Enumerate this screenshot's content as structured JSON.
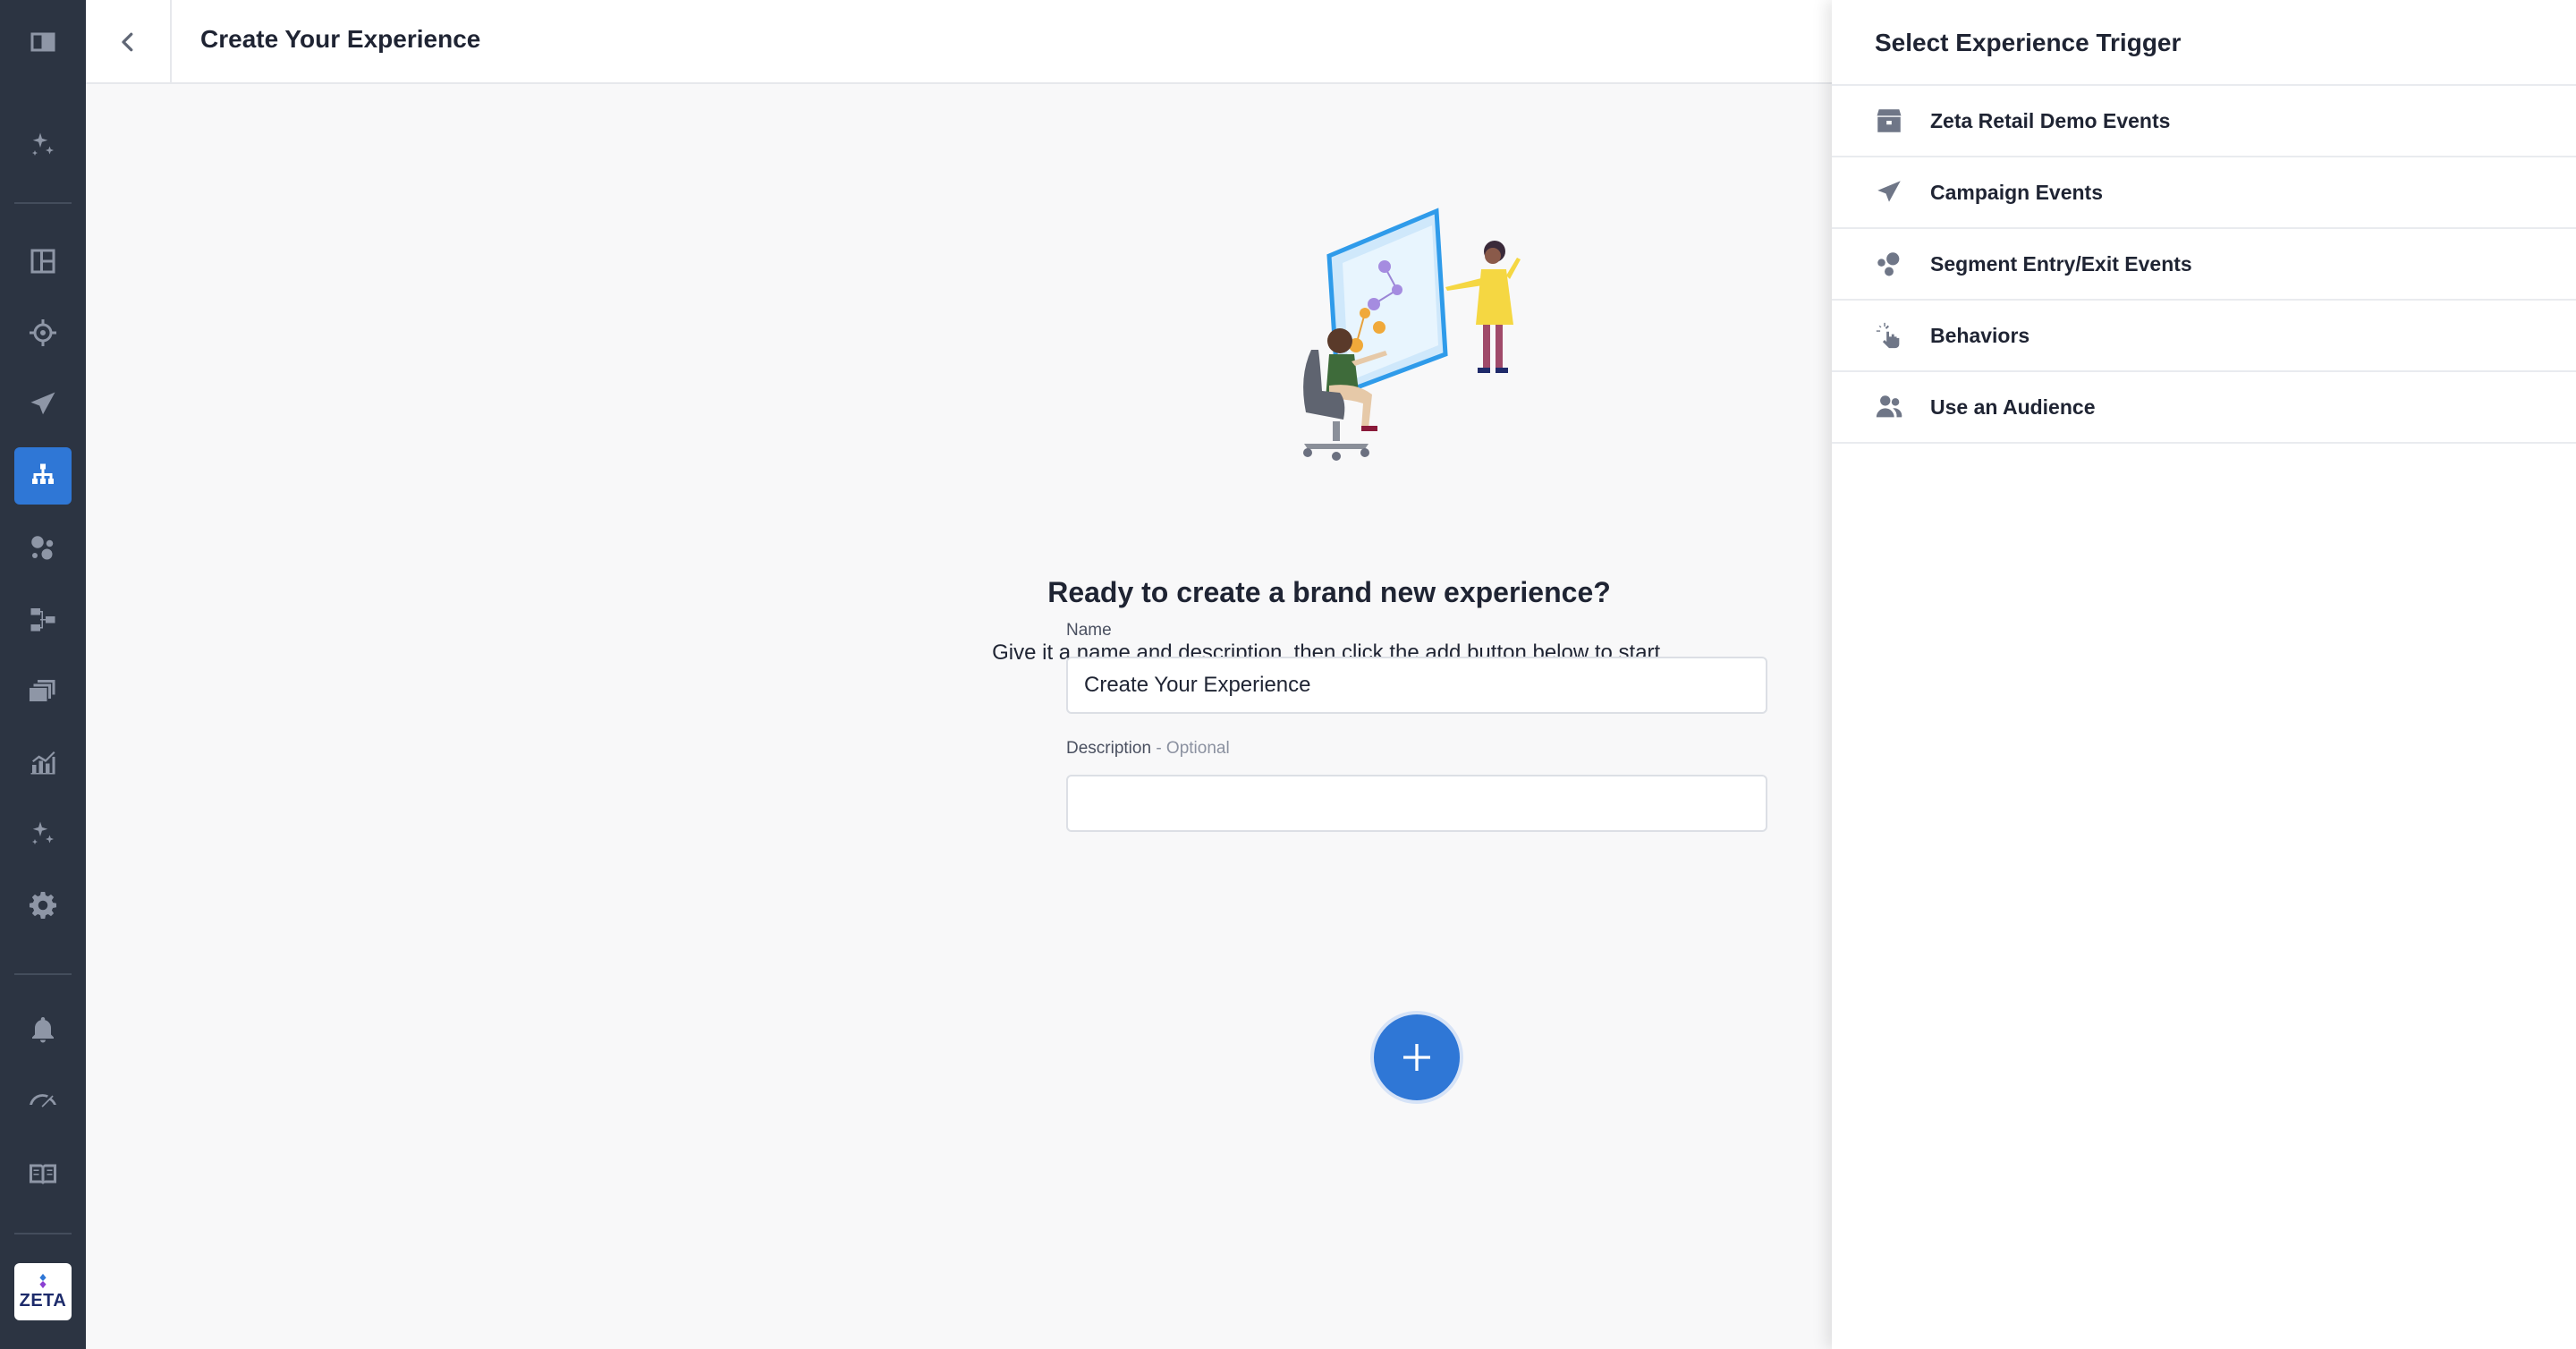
{
  "app": {
    "accent_color": "#2f77d6",
    "sidebar_color": "#2c3442"
  },
  "header": {
    "back_icon": "chevron-left-icon",
    "title": "Create Your Experience"
  },
  "sidebar": {
    "items": [
      {
        "name": "collapse-sidebar",
        "icon": "sidebar-toggle-icon"
      },
      {
        "name": "sparkle",
        "icon": "sparkle-icon"
      },
      {
        "name": "dashboard",
        "icon": "dashboard-icon"
      },
      {
        "name": "targeting",
        "icon": "target-icon"
      },
      {
        "name": "campaigns",
        "icon": "paper-plane-icon"
      },
      {
        "name": "experiences",
        "icon": "hierarchy-icon",
        "active": true
      },
      {
        "name": "segments",
        "icon": "bubbles-icon"
      },
      {
        "name": "workflows",
        "icon": "flow-icon"
      },
      {
        "name": "content",
        "icon": "stack-icon"
      },
      {
        "name": "analytics",
        "icon": "chart-icon"
      },
      {
        "name": "ai",
        "icon": "sparkle-icon"
      },
      {
        "name": "settings",
        "icon": "gear-icon"
      },
      {
        "name": "notifications",
        "icon": "bell-icon"
      },
      {
        "name": "speed",
        "icon": "gauge-icon"
      },
      {
        "name": "docs",
        "icon": "book-icon"
      }
    ],
    "logo_text": "ZETA"
  },
  "main": {
    "heading": "Ready to create a brand new experience?",
    "subheading": "Give it a name and description, then click the add button below to start.",
    "name_label": "Name",
    "name_value": "Create Your Experience",
    "description_label": "Description",
    "description_optional": " - Optional",
    "description_value": "",
    "add_button_icon": "plus-icon"
  },
  "panel": {
    "title": "Select Experience Trigger",
    "triggers": [
      {
        "label": "Zeta Retail Demo Events",
        "icon": "store-icon"
      },
      {
        "label": "Campaign Events",
        "icon": "paper-plane-icon"
      },
      {
        "label": "Segment Entry/Exit Events",
        "icon": "bubbles-icon"
      },
      {
        "label": "Behaviors",
        "icon": "pointer-click-icon"
      },
      {
        "label": "Use an Audience",
        "icon": "users-icon"
      }
    ]
  }
}
